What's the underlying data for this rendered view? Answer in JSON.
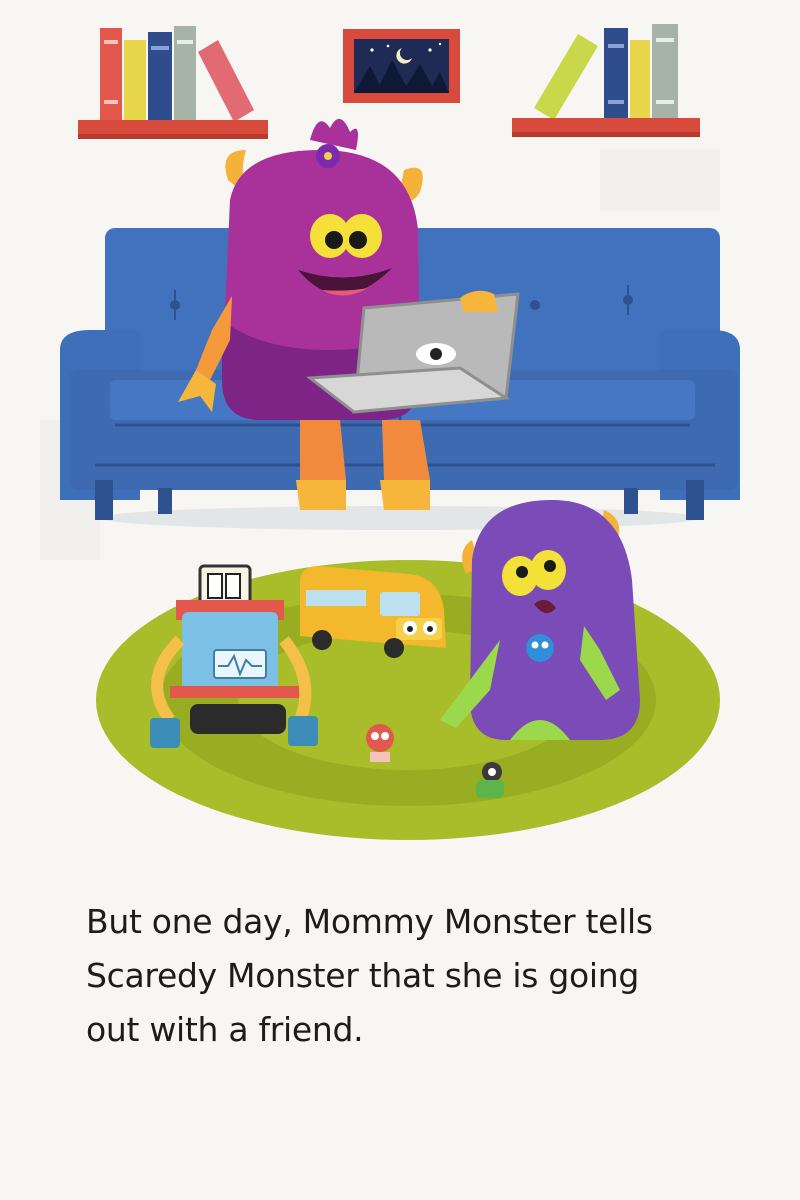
{
  "page": {
    "story_lines": [
      "But one day, Mommy Monster tells",
      "Scaredy Monster that she is going",
      "out with a friend."
    ]
  },
  "illustration": {
    "objects": [
      "bookshelf-left",
      "night-painting",
      "bookshelf-right",
      "blue-sofa",
      "mommy-monster",
      "laptop",
      "green-rug",
      "robot-toy",
      "school-bus-toy",
      "scaredy-monster",
      "small-toy-red",
      "small-toy-green"
    ],
    "colors": {
      "sofa": "#3f6fb8",
      "shelf": "#d84a3c",
      "mommy_fur": "#a8329a",
      "scaredy_fur": "#7b4bb8",
      "rug": "#a9bd2a",
      "bus": "#f3b82b",
      "robot": "#7cc0e6"
    }
  }
}
